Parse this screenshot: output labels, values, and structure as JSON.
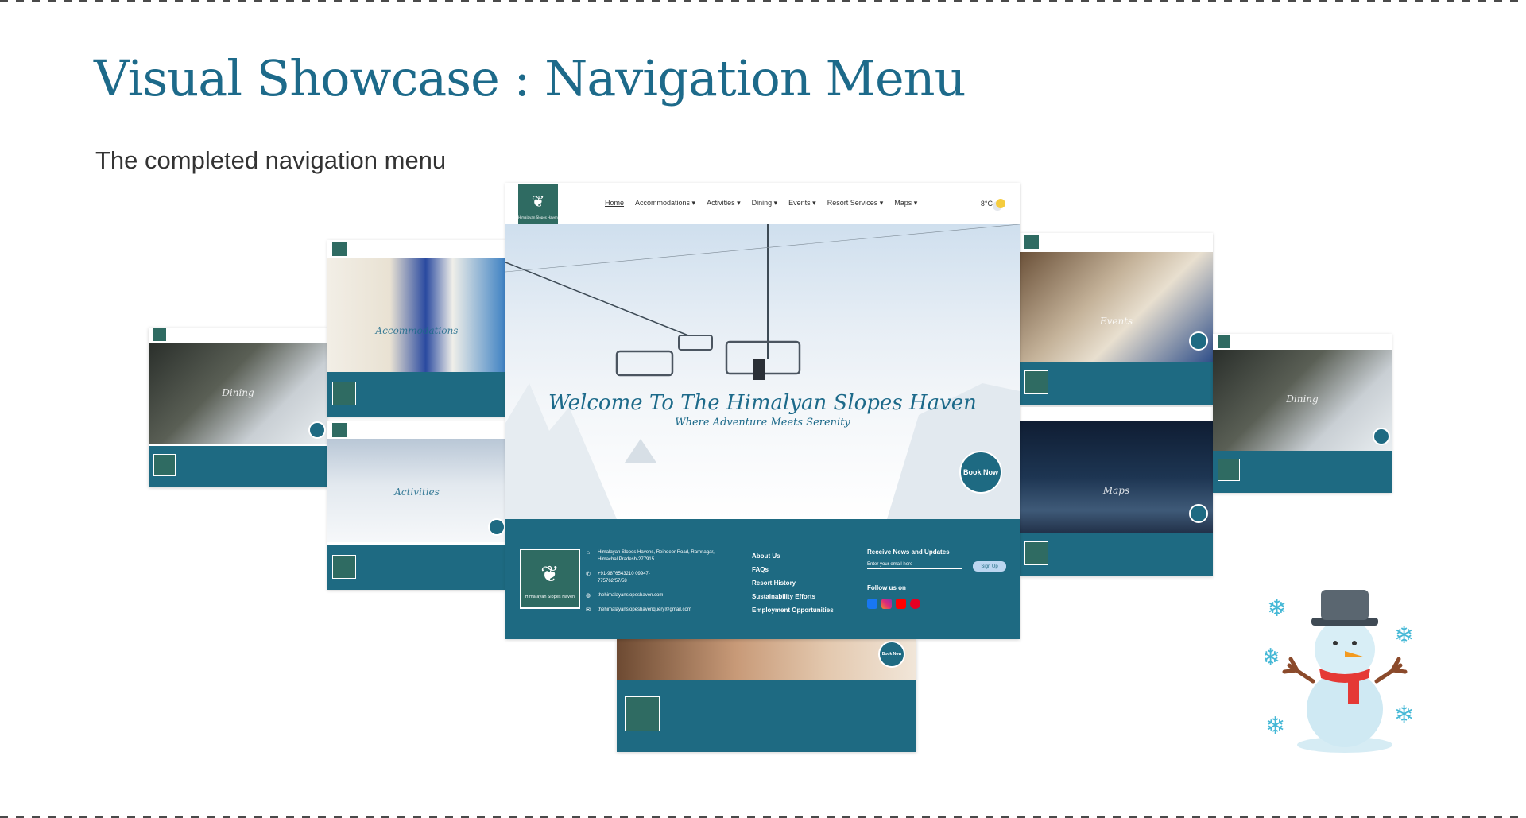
{
  "slide": {
    "title": "Visual Showcase : Navigation Menu",
    "subtitle": "The completed navigation menu"
  },
  "site": {
    "logo_text": "Himalayan Slopes Haven",
    "nav": [
      "Home",
      "Accommodations ▾",
      "Activities ▾",
      "Dining ▾",
      "Events ▾",
      "Resort Services ▾",
      "Maps ▾"
    ],
    "weather": "8°C",
    "hero_title": "Welcome To The Himalyan Slopes Haven",
    "hero_subtitle": "Where Adventure Meets Serenity",
    "book_label": "Book Now",
    "footer": {
      "address": "Himalayan Slopes Havens, Reindeer Road, Ramnagar, Himachal Pradesh-277915",
      "phone": "+91-9876543210 09947-775762/57/58",
      "website": "thehimalayanslopeshaven.com",
      "email": "thehimalayanslopeshavenquery@gmail.com",
      "links": [
        "About Us",
        "FAQs",
        "Resort History",
        "Sustainability Efforts",
        "Employment Opportunities"
      ],
      "newsletter_heading": "Receive News and Updates",
      "email_placeholder": "Enter your email here",
      "signup_label": "Sign Up",
      "follow_label": "Follow us on"
    }
  },
  "thumbnails": {
    "dining": "Dining",
    "accommodations": "Accommodations",
    "activities": "Activities",
    "events": "Events",
    "maps": "Maps"
  },
  "colors": {
    "brand_teal": "#1e6a82",
    "logo_green": "#2f6b62",
    "title_blue": "#1d6a8a"
  }
}
